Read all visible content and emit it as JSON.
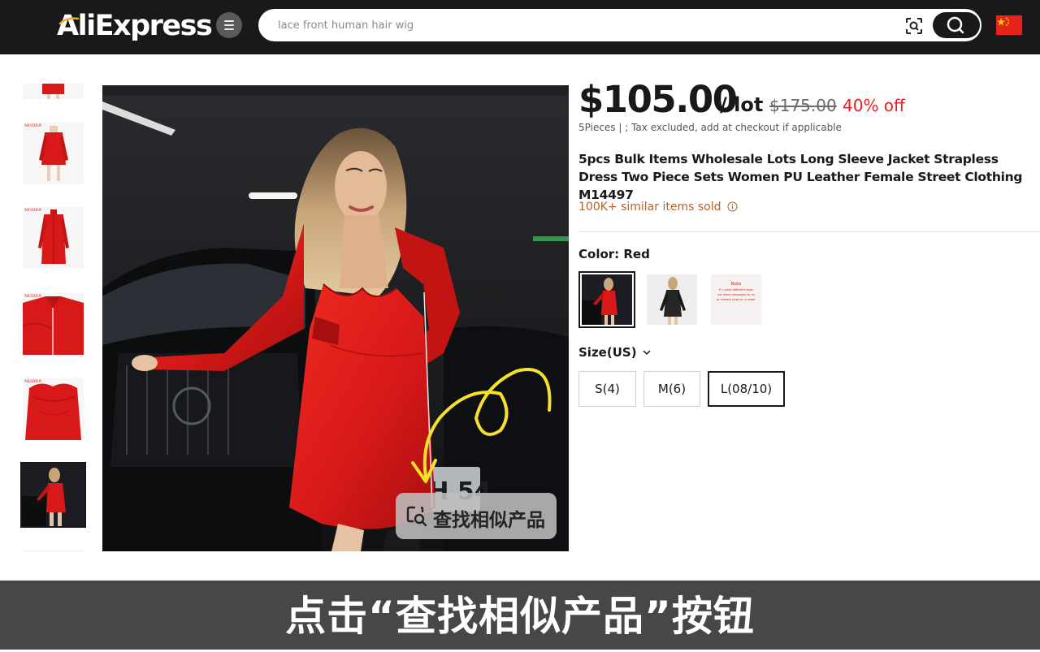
{
  "header": {
    "logo_text": "AliExpress",
    "search_placeholder": "lace front human hair wig",
    "flag": "China"
  },
  "thumbnails": [
    {
      "brand": ""
    },
    {
      "brand": "MODX®"
    },
    {
      "brand": "MODX®"
    },
    {
      "brand": "MODX®"
    },
    {
      "brand": "MODX®"
    },
    {
      "brand": ""
    },
    {
      "brand": ""
    }
  ],
  "main_image": {
    "plate_text": "4FH 54",
    "find_similar_label": "查找相似产品"
  },
  "product": {
    "price": "$105.00",
    "per_lot": "/ lot",
    "original_price": "$175.00",
    "discount": "40% off",
    "tax_note": "5Pieces | ; Tax excluded, add at checkout if applicable",
    "title": "5pcs Bulk Items Wholesale Lots Long Sleeve Jacket Strapless Dress Two Piece Sets Women PU Leather Female Street Clothing M14497",
    "sold": "100K+ similar items sold",
    "color_label": "Color: Red",
    "color_swatches": [
      {
        "name": "Red"
      },
      {
        "name": "Black"
      },
      {
        "name": "Note",
        "note_lines": [
          "Note",
          "If u want different sizes",
          "pls leave messages to us",
          "or remark sizes in ur order"
        ]
      }
    ],
    "size_label": "Size(US)",
    "sizes": [
      "S(4)",
      "M(6)",
      "L(08/10)"
    ],
    "selected_size": "L(08/10)"
  },
  "caption": "点击“查找相似产品”按钮",
  "colors": {
    "header_bg": "#191919",
    "price": "#191919",
    "discount": "#e81e1e",
    "sold": "#b0642a",
    "dress_red": "#d81919",
    "annotation_arrow": "#f7e02a",
    "caption_bg": "#474747"
  }
}
